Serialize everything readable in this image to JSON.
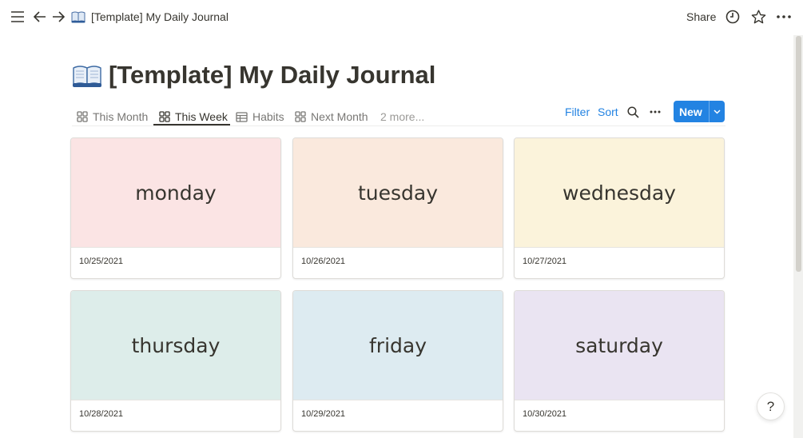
{
  "topbar": {
    "breadcrumb": "[Template] My Daily Journal",
    "share_label": "Share",
    "icons": [
      "menu-icon",
      "back-arrow-icon",
      "forward-arrow-icon",
      "book-icon",
      "clock-icon",
      "star-icon",
      "more-icon"
    ]
  },
  "page": {
    "title": "[Template] My Daily Journal",
    "icon": "open-book-emoji"
  },
  "tabs": [
    {
      "label": "This Month",
      "icon": "gallery-icon",
      "active": false
    },
    {
      "label": "This Week",
      "icon": "gallery-icon",
      "active": true
    },
    {
      "label": "Habits",
      "icon": "table-icon",
      "active": false
    },
    {
      "label": "Next Month",
      "icon": "gallery-icon",
      "active": false
    },
    {
      "label": "2 more...",
      "active": false
    }
  ],
  "controls": {
    "filter_label": "Filter",
    "sort_label": "Sort",
    "new_label": "New"
  },
  "cards": [
    {
      "title": "monday",
      "date": "10/25/2021",
      "color": "#fbe4e4"
    },
    {
      "title": "tuesday",
      "date": "10/26/2021",
      "color": "#fae9dd"
    },
    {
      "title": "wednesday",
      "date": "10/27/2021",
      "color": "#fbf3db"
    },
    {
      "title": "thursday",
      "date": "10/28/2021",
      "color": "#ddedea"
    },
    {
      "title": "friday",
      "date": "10/29/2021",
      "color": "#ddebf1"
    },
    {
      "title": "saturday",
      "date": "10/30/2021",
      "color": "#eae4f2"
    }
  ],
  "help": {
    "label": "?"
  },
  "colors": {
    "accent": "#2383e2",
    "text": "#37352f",
    "muted": "#787774"
  }
}
